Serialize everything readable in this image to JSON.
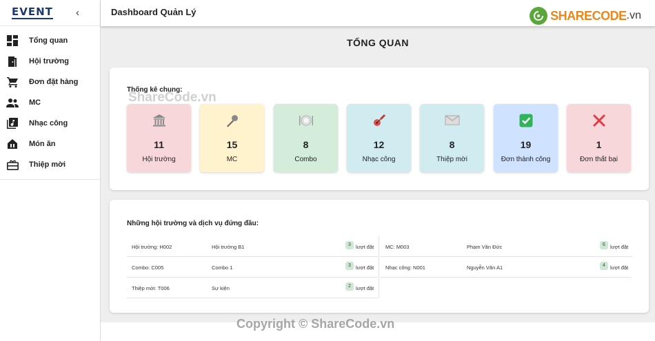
{
  "sidebar": {
    "logo": "EVENT",
    "collapse": "‹",
    "items": [
      {
        "label": "Tổng quan",
        "icon": "dashboard-icon"
      },
      {
        "label": "Hội trường",
        "icon": "door-icon"
      },
      {
        "label": "Đơn đặt hàng",
        "icon": "cart-icon"
      },
      {
        "label": "MC",
        "icon": "people-icon"
      },
      {
        "label": "Nhạc công",
        "icon": "music-library-icon"
      },
      {
        "label": "Món ăn",
        "icon": "restaurant-icon"
      },
      {
        "label": "Thiệp mời",
        "icon": "gift-card-icon"
      }
    ]
  },
  "header": {
    "title": "Dashboard Quản Lý",
    "watermark_brand": "SHARECODE",
    "watermark_tld": ".vn"
  },
  "page": {
    "title": "TỔNG QUAN"
  },
  "overview": {
    "heading": "Thống kê chung:",
    "stats": [
      {
        "value": "11",
        "label": "Hội trường",
        "icon": "bank-icon",
        "bg": "#f8d7da"
      },
      {
        "value": "15",
        "label": "MC",
        "icon": "microphone-icon",
        "bg": "#fff3cd"
      },
      {
        "value": "8",
        "label": "Combo",
        "icon": "plate-icon",
        "bg": "#d4edda"
      },
      {
        "value": "12",
        "label": "Nhạc công",
        "icon": "guitar-icon",
        "bg": "#d1ecf1"
      },
      {
        "value": "8",
        "label": "Thiệp mời",
        "icon": "envelope-icon",
        "bg": "#d1ecf1"
      },
      {
        "value": "19",
        "label": "Đơn thành công",
        "icon": "check-icon",
        "bg": "#cfe2ff"
      },
      {
        "value": "1",
        "label": "Đơn thất bại",
        "icon": "cross-icon",
        "bg": "#f8d7da"
      }
    ]
  },
  "top": {
    "heading": "Những hội trường và dịch vụ đứng đầu:",
    "left": [
      {
        "code": "Hội trường: H002",
        "name": "Hội trường B1",
        "count": "3",
        "unit": "lượt đặt"
      },
      {
        "code": "Combo: C005",
        "name": "Combo 1",
        "count": "3",
        "unit": "lượt đặt"
      },
      {
        "code": "Thiệp mời: T006",
        "name": "Sự kiện",
        "count": "2",
        "unit": "lượt đặt"
      }
    ],
    "right": [
      {
        "code": "MC: M003",
        "name": "Phạm Văn Đức",
        "count": "6",
        "unit": "lượt đặt"
      },
      {
        "code": "Nhạc công: N001",
        "name": "Nguyễn Văn A1",
        "count": "4",
        "unit": "lượt đặt"
      }
    ]
  },
  "watermarks": {
    "center": "ShareCode.vn",
    "footer": "Copyright © ShareCode.vn"
  },
  "colors": {
    "accent_green": "#5aa83a",
    "accent_orange": "#e8881c",
    "badge_green": "#cde9d3"
  }
}
